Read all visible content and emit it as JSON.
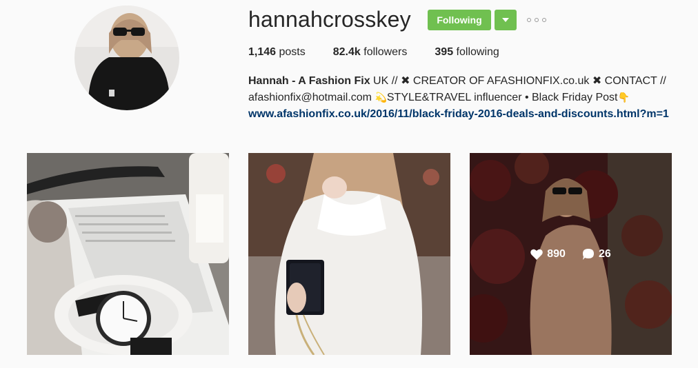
{
  "profile": {
    "username": "hannahcrosskey",
    "follow_label": "Following",
    "stats": [
      {
        "value": "1,146",
        "label": "posts"
      },
      {
        "value": "82.4k",
        "label": "followers"
      },
      {
        "value": "395",
        "label": "following"
      }
    ],
    "bio": {
      "name": "Hannah - A Fashion Fix",
      "line1_rest": " UK // ✖ CREATOR OF AFASHIONFIX.co.uk ✖ CONTACT //",
      "line2_a": "afashionfix@hotmail.com ",
      "sparkle_emoji": "💫",
      "line2_b": "STYLE&TRAVEL influencer • Black Friday Post",
      "point_emoji": "👇",
      "link": "www.afashionfix.co.uk/2016/11/black-friday-2016-deals-and-discounts.html?m=1"
    }
  },
  "posts": [
    {
      "alt": "watch on marble tray with magazine"
    },
    {
      "alt": "white knit sweater with black bag"
    },
    {
      "alt": "tan dress in front of red ivy wall",
      "likes": "890",
      "comments": "26"
    }
  ],
  "colors": {
    "follow_green": "#70c050",
    "link_blue": "#003569",
    "background": "#fafafa"
  },
  "icons": [
    "chevron-down-icon",
    "more-options-icon",
    "heart-icon",
    "comment-icon"
  ]
}
